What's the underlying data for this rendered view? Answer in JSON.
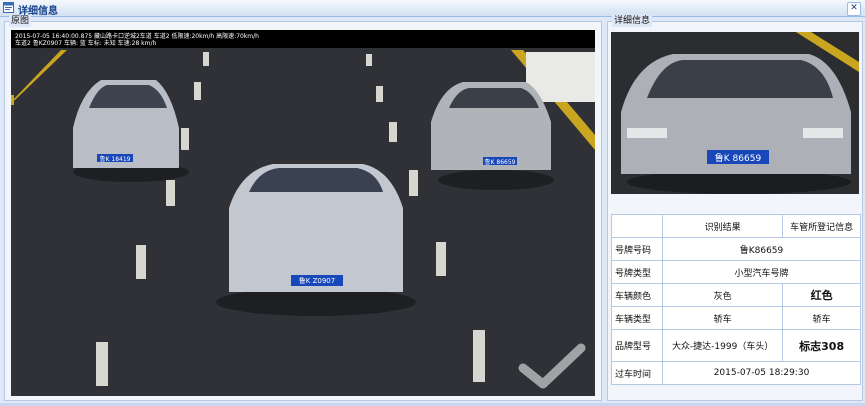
{
  "window": {
    "title": "详细信息",
    "close_glyph": "✕"
  },
  "original_panel": {
    "legend": "原图",
    "overlay_line1": "2015-07-05 16:40:00.875 藏山路卡口逆城2车道 车道2 低限速:20km/h 高限速:70km/h",
    "overlay_line2": "车道2 鲁KZ0907 车辆: 蓝 车标: 未知 车速:28 km/h",
    "plates": [
      "鲁K 18419",
      "鲁K Z0907",
      "鲁K 86659"
    ]
  },
  "detail_panel": {
    "legend": "详细信息",
    "crop_plate": "鲁K 86659",
    "table": {
      "headers": [
        "",
        "识别结果",
        "车管所登记信息"
      ],
      "rows": [
        {
          "label": "号牌号码",
          "value": "鲁K86659"
        },
        {
          "label": "号牌类型",
          "value": "小型汽车号牌"
        },
        {
          "label": "车辆颜色",
          "recognized": "灰色",
          "registered": "红色"
        },
        {
          "label": "车辆类型",
          "recognized": "轿车",
          "registered": "轿车"
        },
        {
          "label": "品牌型号",
          "recognized": "大众-捷达-1999（车头）",
          "registered": "标志308"
        },
        {
          "label": "过车时间",
          "value": "2015-07-05  18:29:30"
        }
      ]
    }
  },
  "colors": {
    "title_text": "#15428b",
    "border": "#b5c9e4",
    "background": "#dfe8f6"
  }
}
